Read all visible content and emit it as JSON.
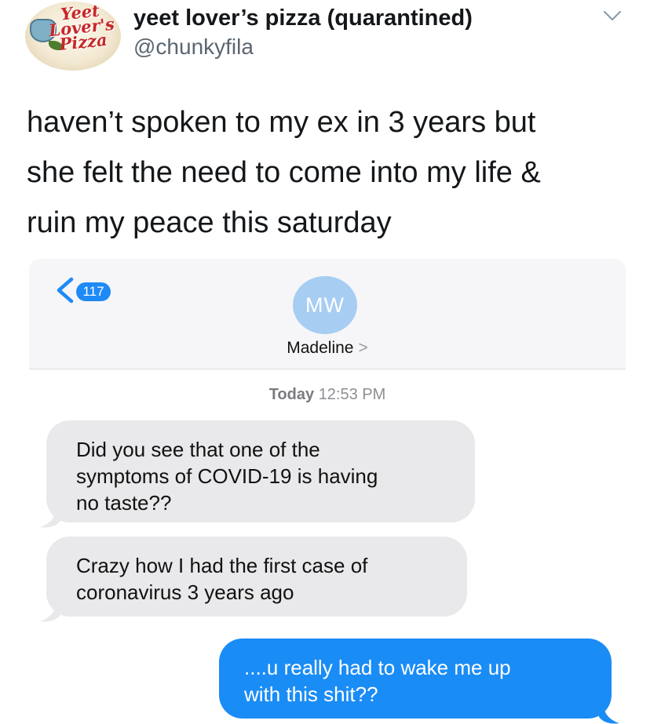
{
  "tweet": {
    "avatar_logo_lines": [
      "Yeet",
      "Lover's",
      "Pizza"
    ],
    "display_name": "yeet lover’s pizza (quarantined)",
    "handle": "@chunkyfila",
    "text": "haven’t spoken to my ex in 3 years but\nshe felt the need to come into my life &\nruin my peace this saturday",
    "menu_icon": "chevron-down-icon"
  },
  "imessage": {
    "back_badge_count": "117",
    "contact_initials": "MW",
    "contact_name": "Madeline",
    "contact_caret": ">",
    "timestamp_day": "Today",
    "timestamp_time": "12:53 PM",
    "messages": [
      {
        "direction": "incoming",
        "text": "Did you see that one of the\nsymptoms of COVID-19 is having\nno taste??"
      },
      {
        "direction": "incoming",
        "text": "Crazy how I had the first case of\ncoronavirus 3 years ago"
      },
      {
        "direction": "outgoing",
        "text": "....u really had to wake me up\nwith this shit??"
      }
    ],
    "colors": {
      "incoming_bubble": "#e9e9eb",
      "outgoing_bubble": "#1a8cf5",
      "accent": "#1f8af5",
      "avatar": "#a7cdf2"
    }
  }
}
